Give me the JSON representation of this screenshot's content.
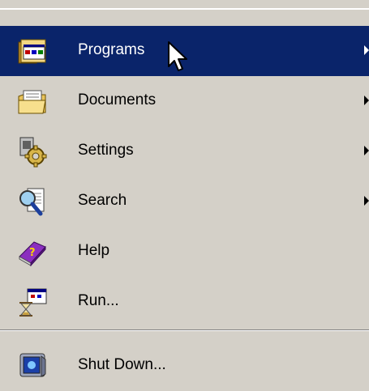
{
  "start_menu": {
    "items": [
      {
        "label": "Programs",
        "icon": "programs-folder-icon",
        "has_submenu": true,
        "highlighted": true
      },
      {
        "label": "Documents",
        "icon": "documents-folder-icon",
        "has_submenu": true,
        "highlighted": false
      },
      {
        "label": "Settings",
        "icon": "settings-gear-icon",
        "has_submenu": true,
        "highlighted": false
      },
      {
        "label": "Search",
        "icon": "search-magnifier-icon",
        "has_submenu": true,
        "highlighted": false
      },
      {
        "label": "Help",
        "icon": "help-book-icon",
        "has_submenu": false,
        "highlighted": false
      },
      {
        "label": "Run...",
        "icon": "run-hourglass-icon",
        "has_submenu": false,
        "highlighted": false
      }
    ],
    "shutdown": {
      "label": "Shut Down...",
      "icon": "shutdown-computer-icon"
    }
  },
  "colors": {
    "menu_background": "#d4d0c8",
    "highlight_background": "#0a246a",
    "highlight_text": "#ffffff",
    "text": "#000000"
  }
}
